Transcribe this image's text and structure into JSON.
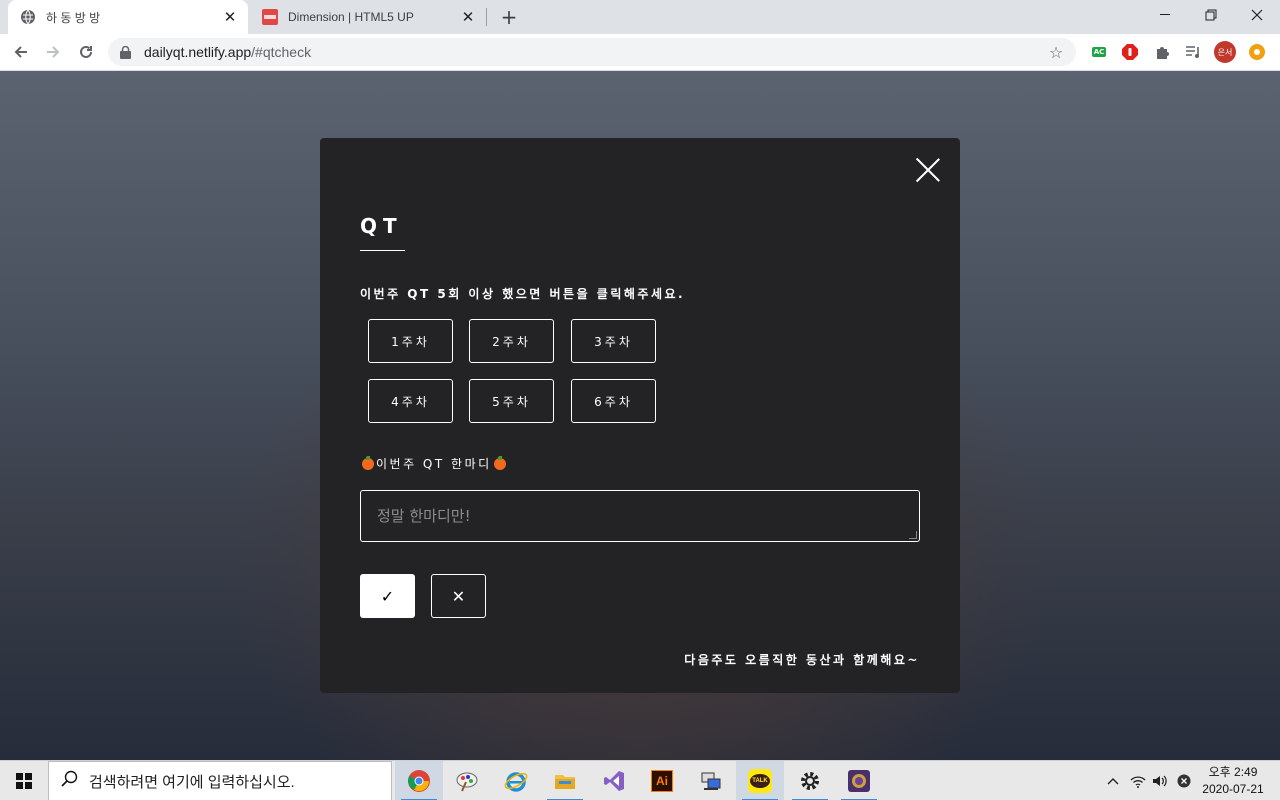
{
  "browser": {
    "tabs": [
      {
        "title": "하 동 방 방",
        "icon": "globe-icon"
      },
      {
        "title": "Dimension | HTML5 UP",
        "icon": "html5up-favicon"
      }
    ],
    "url_host": "dailyqt.netlify.app",
    "url_path": "/#qtcheck",
    "profile_initials": "은서",
    "extension_badge": "AC"
  },
  "modal": {
    "title": "QT",
    "instruction": "이번주 QT 5회 이상 했으면 버튼을 클릭해주세요.",
    "weeks": [
      "1주차",
      "2주차",
      "3주차",
      "4주차",
      "5주차",
      "6주차"
    ],
    "comment_label": "이번주 QT 한마디",
    "comment_placeholder": "정말 한마디만!",
    "confirm_label": "✓",
    "cancel_label": "✕",
    "footer": "다음주도 오름직한 동산과 함께해요~"
  },
  "taskbar": {
    "search_placeholder": "검색하려면 여기에 입력하십시오.",
    "apps": [
      "chrome-icon",
      "paint-icon",
      "internet-explorer-icon",
      "file-explorer-icon",
      "visual-studio-icon",
      "illustrator-icon",
      "network-icon",
      "kakaotalk-icon",
      "settings-icon",
      "game-icon"
    ],
    "kakaotalk_label": "TALK",
    "illustrator_label": "Ai",
    "clock_time": "오후 2:49",
    "clock_date": "2020-07-21"
  },
  "colors": {
    "modal_bg": "#232326",
    "page_top": "#5b6370",
    "page_bottom": "#262c3a"
  }
}
